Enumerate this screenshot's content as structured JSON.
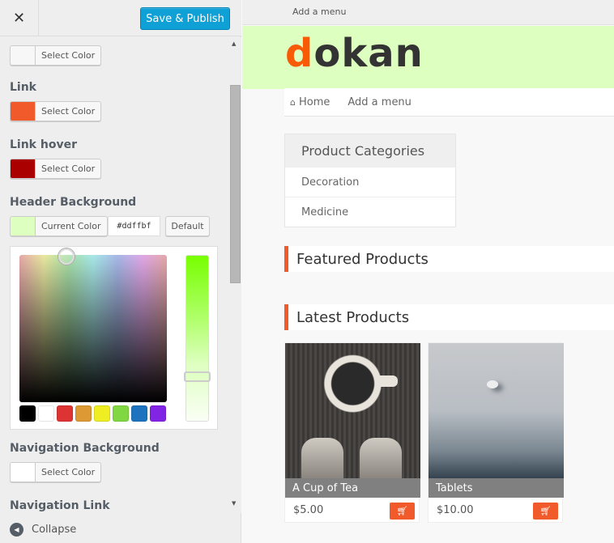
{
  "sidebar": {
    "close_icon": "✕",
    "save_label": "Save & Publish",
    "controls": [
      {
        "label": "",
        "button": "Select Color",
        "color": "#f7f7f7"
      },
      {
        "label": "Link",
        "button": "Select Color",
        "color": "#f15a2b"
      },
      {
        "label": "Link hover",
        "button": "Select Color",
        "color": "#aa0000"
      },
      {
        "label": "Header Background",
        "button": "Current Color",
        "color": "#ddffbf",
        "hex": "#ddffbf",
        "default_label": "Default"
      },
      {
        "label": "Navigation Background",
        "button": "Select Color",
        "color": "#ffffff"
      },
      {
        "label": "Navigation Link"
      }
    ],
    "palette": [
      "#000000",
      "#ffffff",
      "#dd3333",
      "#dd9933",
      "#eeee22",
      "#81d742",
      "#1e73be",
      "#8224e3"
    ],
    "collapse_label": "Collapse"
  },
  "preview": {
    "topbar_link": "Add a menu",
    "logo_first": "d",
    "logo_rest": "okan",
    "nav": {
      "home": "Home",
      "add_menu": "Add a menu"
    },
    "categories": {
      "title": "Product Categories",
      "items": [
        "Decoration",
        "Medicine"
      ]
    },
    "featured_title": "Featured Products",
    "latest_title": "Latest Products",
    "products": [
      {
        "name": "A Cup of Tea",
        "price": "$5.00"
      },
      {
        "name": "Tablets",
        "price": "$10.00"
      }
    ]
  }
}
